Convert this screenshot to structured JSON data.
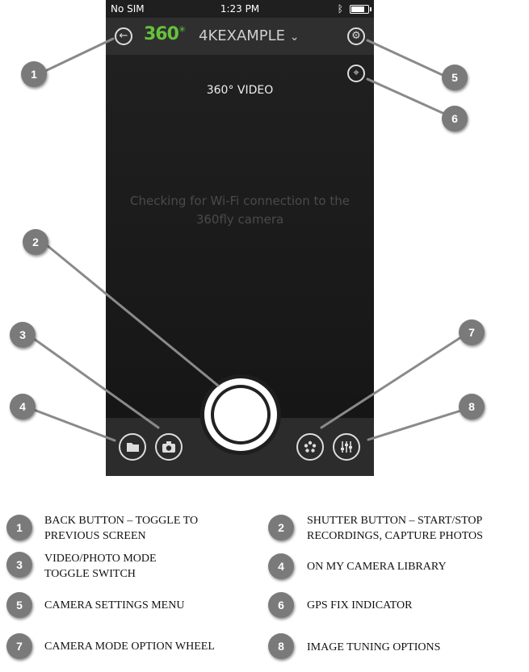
{
  "status_bar": {
    "carrier": "No SIM",
    "time": "1:23 PM"
  },
  "app_bar": {
    "logo_text": "360",
    "camera_name": "4KEXAMPLE"
  },
  "viewfinder": {
    "mode_label": "360° VIDEO",
    "message": "Checking for Wi-Fi connection to the 360fly camera"
  },
  "icons": {
    "back": "back-arrow-icon",
    "settings": "gear-icon",
    "gps": "location-pin-icon",
    "library": "folder-icon",
    "mode_toggle": "camera-icon",
    "mode_wheel": "mode-wheel-icon",
    "tuning": "sliders-icon",
    "bluetooth": "bluetooth-icon",
    "battery": "battery-icon"
  },
  "colors": {
    "logo": "#65c23a",
    "callout": "#7a7a7a"
  },
  "callout_numbers": [
    "1",
    "2",
    "3",
    "4",
    "5",
    "6",
    "7",
    "8"
  ],
  "legend": [
    {
      "n": "1",
      "text": "BACK BUTTON – TOGGLE TO PREVIOUS SCREEN"
    },
    {
      "n": "2",
      "text": "SHUTTER BUTTON – START/STOP RECORDINGS, CAPTURE PHOTOS"
    },
    {
      "n": "3",
      "text": "VIDEO/PHOTO MODE TOGGLE SWITCH"
    },
    {
      "n": "4",
      "text": "ON MY CAMERA LIBRARY"
    },
    {
      "n": "5",
      "text": "CAMERA SETTINGS MENU"
    },
    {
      "n": "6",
      "text": "GPS FIX INDICATOR"
    },
    {
      "n": "7",
      "text": "CAMERA MODE OPTION WHEEL"
    },
    {
      "n": "8",
      "text": "IMAGE TUNING OPTIONS"
    }
  ]
}
